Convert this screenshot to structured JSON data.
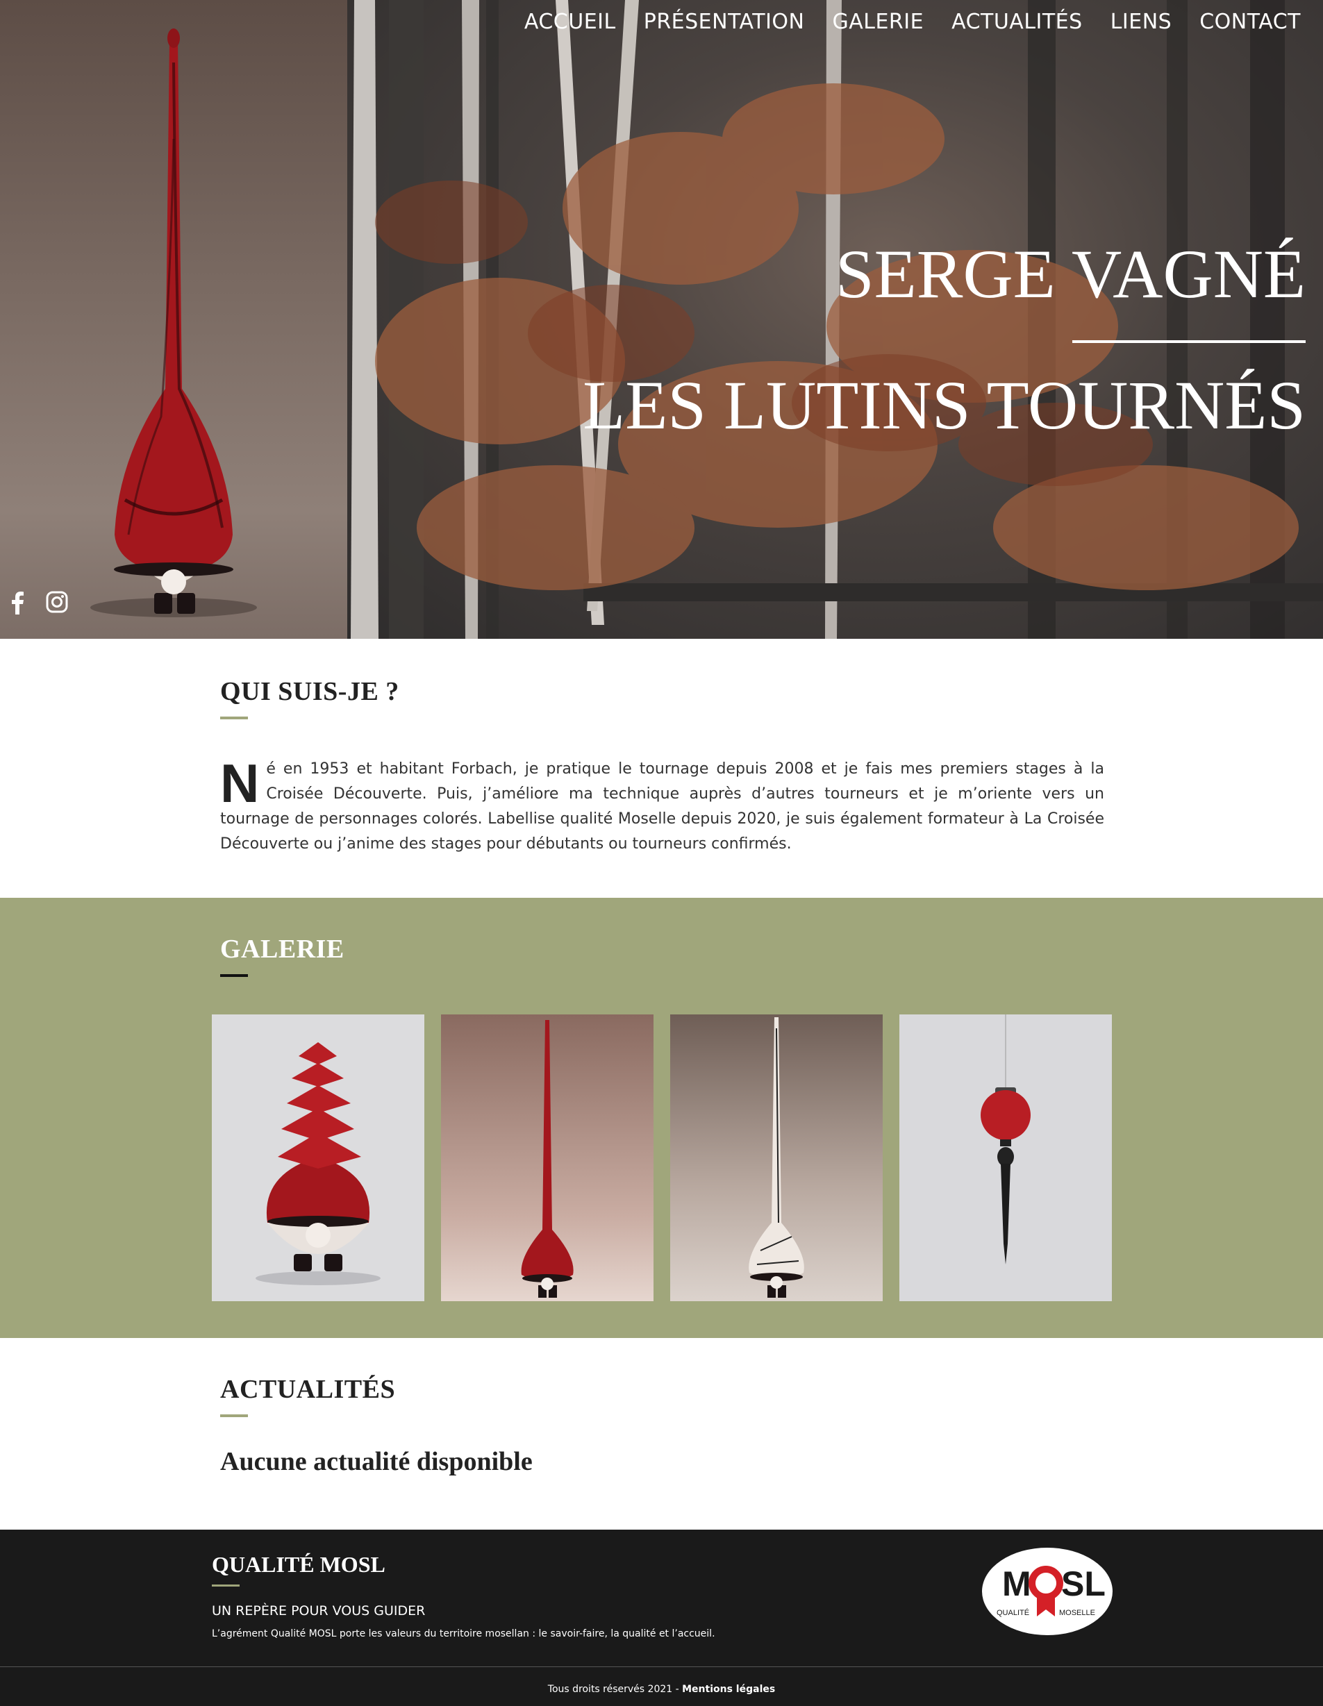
{
  "nav": {
    "items": [
      "ACCUEIL",
      "PRÉSENTATION",
      "GALERIE",
      "ACTUALITÉS",
      "LIENS",
      "CONTACT"
    ]
  },
  "hero": {
    "title_line1": "SERGE VAGNÉ",
    "title_line2": "LES LUTINS TOURNÉS"
  },
  "socials": [
    "facebook-icon",
    "instagram-icon"
  ],
  "about": {
    "title": "QUI SUIS-JE ?",
    "drop_letter": "N",
    "text": "é en 1953 et habitant Forbach, je pratique le tournage depuis 2008 et je fais mes premiers stages à la Croisée Découverte. Puis, j’améliore ma technique auprès d’autres tourneurs et je m’oriente vers un tournage de personnages colorés. Labellise qualité Moselle depuis 2020, je suis également formateur à La Croisée Découverte ou j’anime des stages pour débutants ou tourneurs confirmés."
  },
  "gallery": {
    "title": "GALERIE",
    "images": [
      "stacked-hat-gnome",
      "red-tall-gnome",
      "white-tall-gnome",
      "red-ornament"
    ]
  },
  "news": {
    "title": "ACTUALITÉS",
    "empty": "Aucune actualité disponible"
  },
  "footer": {
    "title": "QUALITÉ MOSL",
    "subtitle": "UN REPÈRE POUR VOUS GUIDER",
    "description": "L’agrément Qualité MOSL porte les valeurs du territoire mosellan : le savoir-faire, la qualité et l’accueil.",
    "logo": {
      "m": "M",
      "o": "O",
      "sl": "SL",
      "q": "QUALITÉ",
      "moselle": "MOSELLE"
    },
    "copyright": "Tous droits réservés 2021 - ",
    "legal": "Mentions légales"
  },
  "colors": {
    "accent": "#a0a67b",
    "footer_bg": "#1a1a1a",
    "gnome_red": "#b81e24"
  }
}
